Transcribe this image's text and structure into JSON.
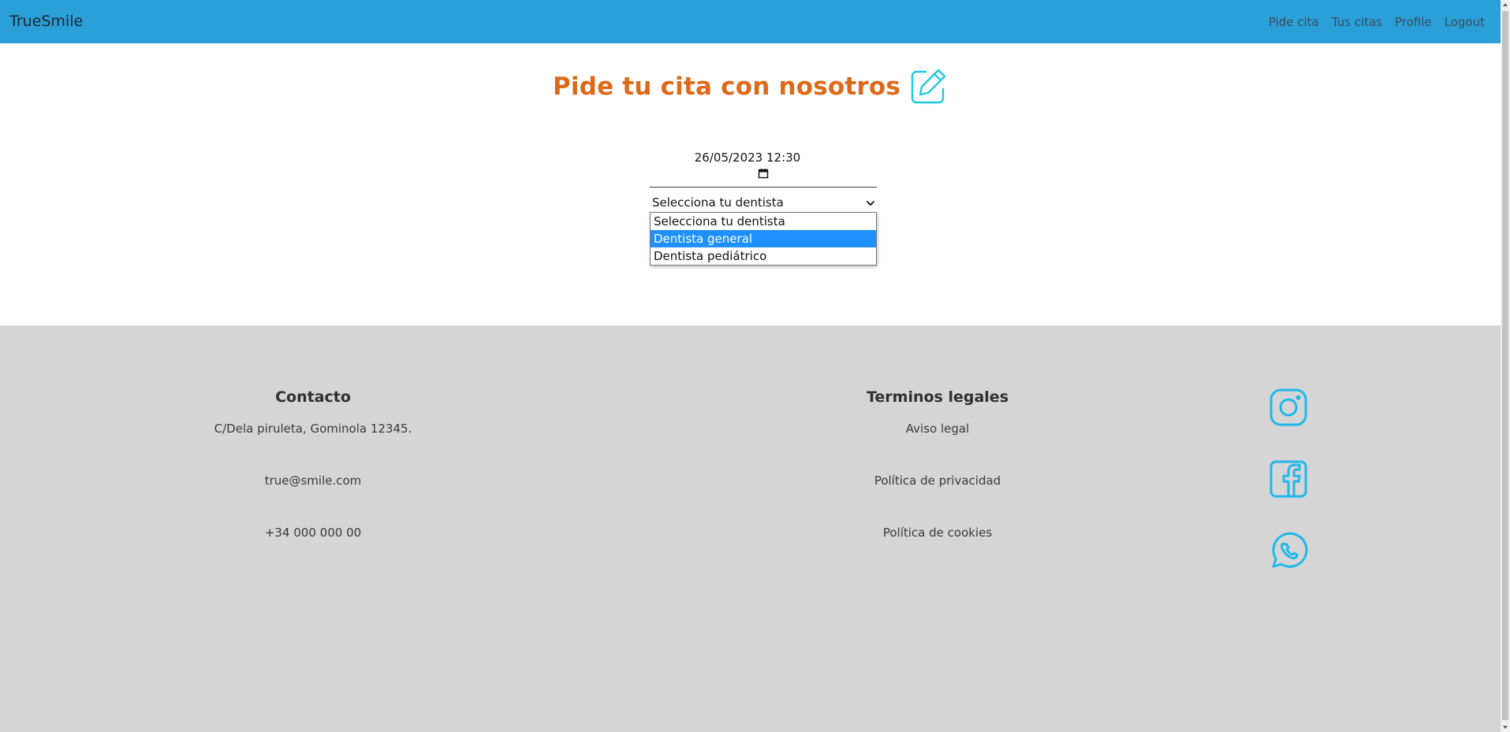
{
  "navbar": {
    "brand": "TrueSmile",
    "links": [
      "Pide cita",
      "Tus citas",
      "Profile",
      "Logout"
    ],
    "background": "#2a9fd8"
  },
  "main": {
    "title": "Pide tu cita con nosotros",
    "title_color": "#dc6a1a",
    "title_icon": "edit-icon",
    "datetime_value": "26/05/2023 12:30",
    "select": {
      "value": "Selecciona tu dentista",
      "options": [
        "Selecciona tu dentista",
        "Dentista general",
        "Dentista pediátrico"
      ],
      "highlighted_option": "Dentista general"
    }
  },
  "footer": {
    "contact": {
      "heading": "Contacto",
      "address": "C/Dela piruleta, Gominola 12345.",
      "email": "true@smile.com",
      "phone": "+34 000 000 00"
    },
    "legal": {
      "heading": "Terminos legales",
      "links": [
        "Aviso legal",
        "Política de privacidad",
        "Política de cookies"
      ]
    },
    "social_icons": [
      "instagram-icon",
      "facebook-icon",
      "whatsapp-icon"
    ],
    "icon_color": "#1fb8e8",
    "background": "#d6d5d6"
  }
}
